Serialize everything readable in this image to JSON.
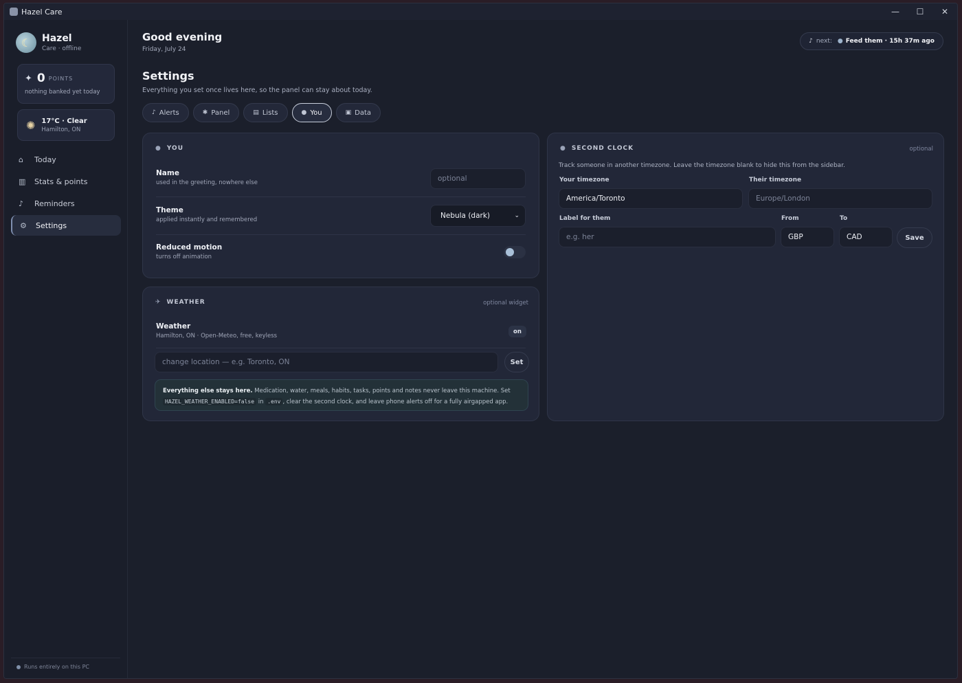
{
  "window": {
    "title": "Hazel Care",
    "minimize": "—",
    "maximize": "☐",
    "close": "✕"
  },
  "sidebar": {
    "brand_name": "Hazel",
    "brand_sub": "Care · offline",
    "points_value": "0",
    "points_label": "POINTS",
    "points_note": "nothing banked yet today",
    "weather_temp": "17°C · Clear",
    "weather_loc": "Hamilton, ON",
    "nav": [
      {
        "label": "Today",
        "icon": "house-icon"
      },
      {
        "label": "Stats & points",
        "icon": "chart-icon"
      },
      {
        "label": "Reminders",
        "icon": "bell-icon"
      },
      {
        "label": "Settings",
        "icon": "gear-icon"
      }
    ],
    "footer": "Runs entirely on this PC"
  },
  "header": {
    "greeting": "Good evening",
    "date": "Friday, July 24",
    "next_label": "next:",
    "next_value": "Feed them · 15h 37m ago"
  },
  "settings": {
    "title": "Settings",
    "subtitle": "Everything you set once lives here, so the panel can stay about today.",
    "tabs": [
      {
        "label": "Alerts",
        "icon": "bell-icon"
      },
      {
        "label": "Panel",
        "icon": "puzzle-icon"
      },
      {
        "label": "Lists",
        "icon": "list-icon"
      },
      {
        "label": "You",
        "icon": "person-icon"
      },
      {
        "label": "Data",
        "icon": "lock-icon"
      }
    ],
    "active_tab": "You"
  },
  "you_panel": {
    "heading": "YOU",
    "name_label": "Name",
    "name_hint": "used in the greeting, nowhere else",
    "name_placeholder": "optional",
    "theme_label": "Theme",
    "theme_hint": "applied instantly and remembered",
    "theme_value": "Nebula (dark)",
    "motion_label": "Reduced motion",
    "motion_hint": "turns off animation"
  },
  "weather_panel": {
    "heading": "WEATHER",
    "tag": "optional widget",
    "label": "Weather",
    "hint": "Hamilton, ON · Open-Meteo, free, keyless",
    "badge": "on",
    "location_placeholder": "change location — e.g. Toronto, ON",
    "set_button": "Set",
    "info_bold": "Everything else stays here.",
    "info_text1": " Medication, water, meals, habits, tasks, points and notes never leave this machine. Set ",
    "info_code1": "HAZEL_WEATHER_ENABLED=false",
    "info_text2": " in ",
    "info_code2": ".env",
    "info_text3": ", clear the second clock, and leave phone alerts off for a fully airgapped app."
  },
  "clock_panel": {
    "heading": "SECOND CLOCK",
    "tag": "optional",
    "description": "Track someone in another timezone. Leave the timezone blank to hide this from the sidebar.",
    "your_tz_label": "Your timezone",
    "your_tz_value": "America/Toronto",
    "their_tz_label": "Their timezone",
    "their_tz_placeholder": "Europe/London",
    "label_for_them": "Label for them",
    "label_placeholder": "e.g. her",
    "from_label": "From",
    "from_value": "GBP",
    "to_label": "To",
    "to_value": "CAD",
    "save_button": "Save"
  }
}
